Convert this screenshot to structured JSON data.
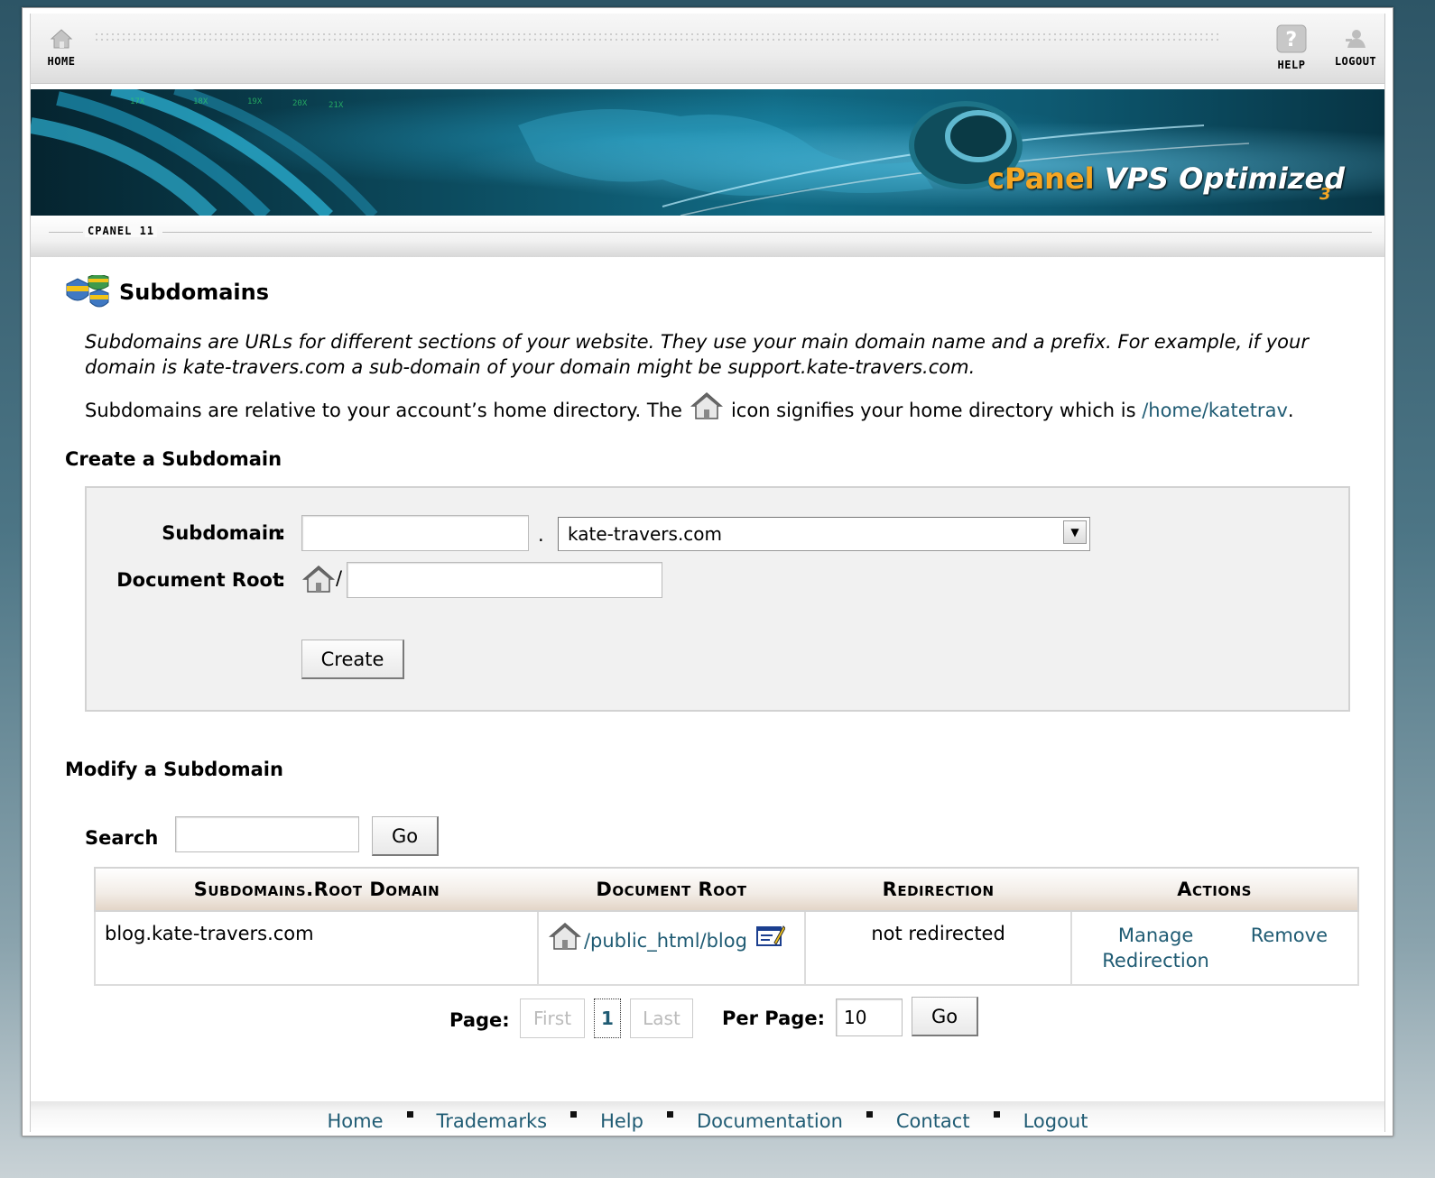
{
  "nav": {
    "home_label": "HOME",
    "help_label": "HELP",
    "logout_label": "LOGOUT"
  },
  "banner": {
    "brand": "cPanel",
    "product": "VPS Optimized",
    "version_mark": "3"
  },
  "version_label": "CPANEL 11",
  "page": {
    "title": "Subdomains",
    "description": "Subdomains are URLs for different sections of your website. They use your main domain name and a prefix. For example, if your domain is kate-travers.com a sub-domain of your domain might be support.kate-travers.com.",
    "home_note_before": "Subdomains are relative to your account’s home directory. The",
    "home_note_after": "icon signifies your home directory which is",
    "home_dir": "/home/katetrav",
    "home_note_end": "."
  },
  "create": {
    "heading": "Create a Subdomain",
    "subdomain_label": "Subdomain",
    "subdomain_value": "",
    "dot": ".",
    "domain_selected": "kate-travers.com",
    "docroot_label": "Document Root",
    "docroot_slash": "/",
    "docroot_value": "",
    "colon": ":",
    "create_button": "Create"
  },
  "modify": {
    "heading": "Modify a Subdomain",
    "search_label": "Search",
    "search_value": "",
    "go_button": "Go",
    "table": {
      "headers": [
        "Subdomains.Root Domain",
        "Document Root",
        "Redirection",
        "Actions"
      ],
      "rows": [
        {
          "subdomain": "blog.kate-travers.com",
          "docroot": "/public_html/blog",
          "redirection": "not redirected",
          "manage_line1": "Manage",
          "manage_line2": "Redirection",
          "remove": "Remove"
        }
      ]
    },
    "pager": {
      "page_label": "Page:",
      "first": "First",
      "current": "1",
      "last": "Last",
      "per_page_label": "Per Page:",
      "per_page_value": "10",
      "go_button": "Go"
    }
  },
  "footer": {
    "links": [
      "Home",
      "Trademarks",
      "Help",
      "Documentation",
      "Contact",
      "Logout"
    ]
  },
  "colors": {
    "link": "#1f5b73",
    "banner_dark": "#073444",
    "brand_orange": "#f5a623"
  }
}
